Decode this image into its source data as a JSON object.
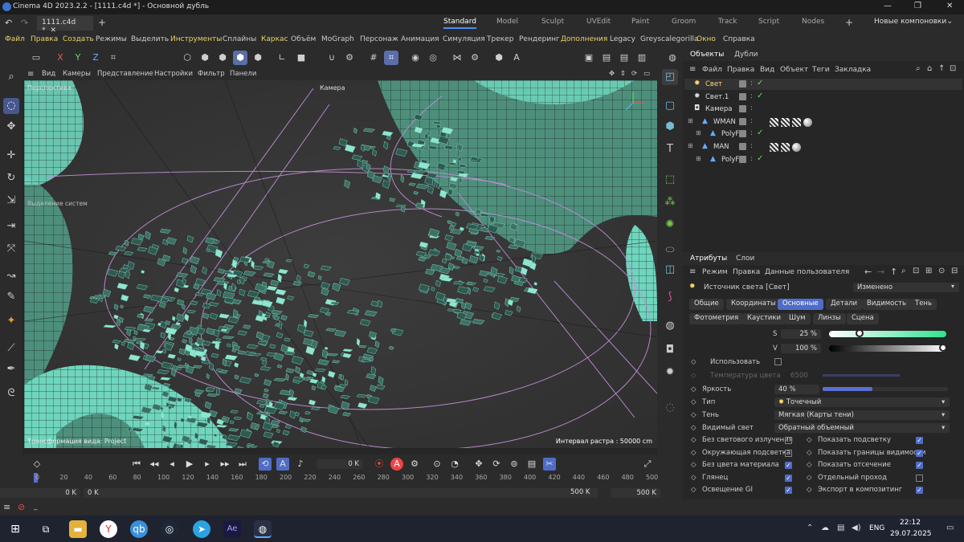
{
  "window": {
    "title": "Cinema 4D 2023.2.2 - [1111.c4d *] - Основной дубль",
    "min": "—",
    "max": "❐",
    "close": "✕"
  },
  "tabs": {
    "file_tab": "1111.c4d *",
    "close": "✕",
    "add": "+",
    "layouts": [
      "Standard",
      "Model",
      "Sculpt",
      "UVEdit",
      "Paint",
      "Groom",
      "Track",
      "Script",
      "Nodes"
    ],
    "new_layouts": "Новые компоновки"
  },
  "menubar": [
    "Файл",
    "Правка",
    "Создать",
    "Режимы",
    "Выделить",
    "Инструменты",
    "Сплайны",
    "Каркас",
    "Объём",
    "MoGraph",
    "Персонаж",
    "Анимация",
    "Симуляция",
    "Трекер",
    "Рендеринг",
    "Дополнения",
    "Legacy",
    "Greyscalegorilla",
    "Окно",
    "Справка"
  ],
  "viewport": {
    "menu": [
      "Вид",
      "Камеры",
      "Представление",
      "Настройки",
      "Фильтр",
      "Панели"
    ],
    "label_persp": "Перспектива",
    "label_camera": "Камера",
    "label_selection": "Выделение систем",
    "label_transform": "Трансформация вида: Project",
    "grid_interval": "Интервал растра : 50000 cm"
  },
  "timeline": {
    "frame_field": "0 K",
    "ticks": [
      "0",
      "20",
      "40",
      "60",
      "80",
      "100",
      "120",
      "140",
      "160",
      "180",
      "200",
      "220",
      "240",
      "260",
      "280",
      "300",
      "320",
      "340",
      "360",
      "380",
      "400",
      "420",
      "440",
      "460",
      "480",
      "500"
    ],
    "start": "0 K",
    "current": "0 K",
    "end_field": "500 K",
    "end_field2": "500 K"
  },
  "objects": {
    "tab_objects": "Объекты",
    "tab_takes": "Дубли",
    "menu": [
      "Файл",
      "Правка",
      "Вид",
      "Объект",
      "Теги",
      "Закладка"
    ],
    "items": [
      {
        "name": "Свет",
        "selected": true
      },
      {
        "name": "Свет.1",
        "selected": false
      },
      {
        "name": "Камера",
        "selected": false
      },
      {
        "name": "WMAN",
        "selected": false
      },
      {
        "name": "PolyFx",
        "selected": false
      },
      {
        "name": "MAN",
        "selected": false
      },
      {
        "name": "PolyFx",
        "selected": false
      }
    ]
  },
  "attributes": {
    "tab_attr": "Атрибуты",
    "tab_layers": "Слои",
    "menu": [
      "Режим",
      "Правка",
      "Данные пользователя"
    ],
    "object": "Источник света [Свет]",
    "state": "Изменено",
    "tabs_row1": [
      "Общие",
      "Координаты",
      "Основные",
      "Детали",
      "Видимость",
      "Тень"
    ],
    "tabs_row2": [
      "Фотометрия",
      "Каустики",
      "Шум",
      "Линзы",
      "Сцена"
    ],
    "active_tab": "Основные",
    "s_label": "S",
    "s_value": "25 %",
    "v_label": "V",
    "v_value": "100 %",
    "use_label": "Использовать",
    "temp_label": "Температура цвета",
    "temp_value": "6500",
    "bright_label": "Яркость",
    "bright_value": "40 %",
    "bright_level": 0.4,
    "type_label": "Тип",
    "type_value": "Точечный",
    "shadow_label": "Тень",
    "shadow_value": "Мягкая (Карты тени)",
    "visible_label": "Видимый свет",
    "visible_value": "Обратный объемный",
    "checks_left": [
      {
        "label": "Без светового излучения",
        "on": false
      },
      {
        "label": "Окружающая подсветка",
        "on": false
      },
      {
        "label": "Без цвета материала",
        "on": true
      },
      {
        "label": "Глянец",
        "on": true
      },
      {
        "label": "Освещение GI",
        "on": true
      }
    ],
    "checks_right": [
      {
        "label": "Показать подсветку",
        "on": true
      },
      {
        "label": "Показать границы видимости",
        "on": true
      },
      {
        "label": "Показать отсечение",
        "on": true
      },
      {
        "label": "Отдельный проход",
        "on": false
      },
      {
        "label": "Экспорт в композитинг",
        "on": true
      }
    ]
  },
  "statusbar": {
    "text": "_"
  },
  "taskbar": {
    "lang": "ENG",
    "time": "22:12",
    "date": "29.07.2025"
  },
  "colors": {
    "accent": "#4f6cc7",
    "mesh": "#2f5a52",
    "teal": "#7fe6c9"
  }
}
